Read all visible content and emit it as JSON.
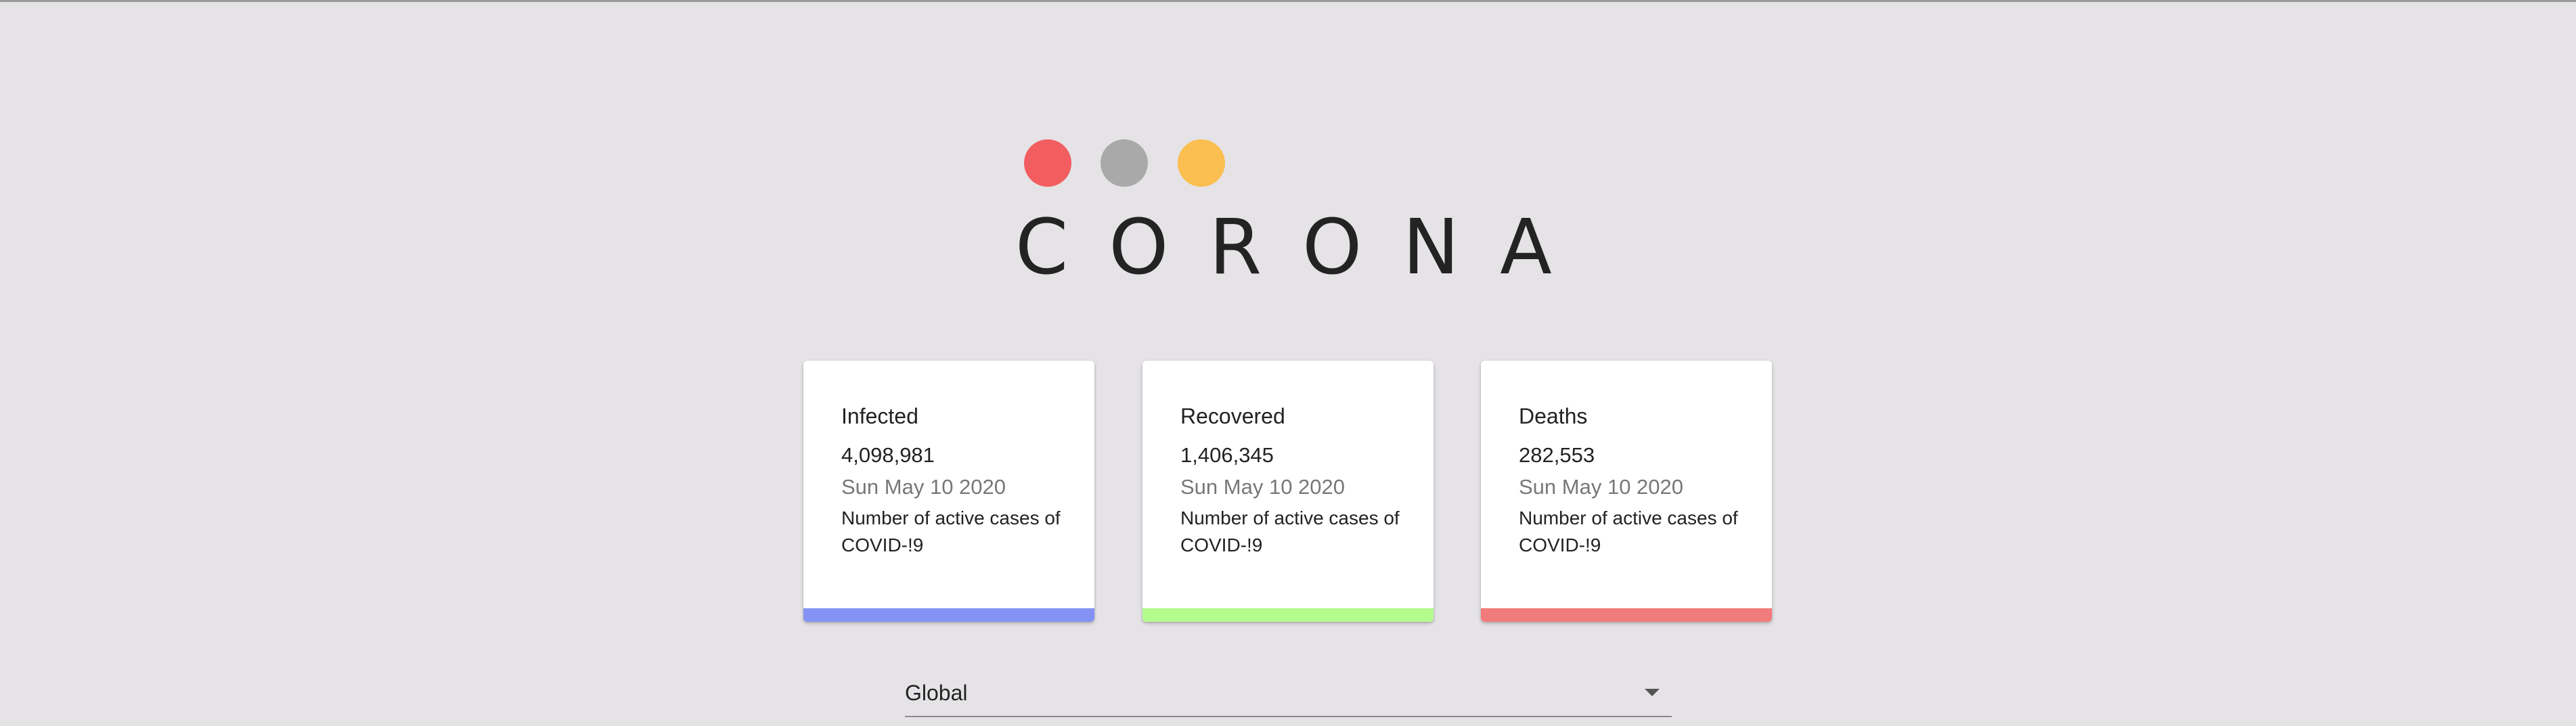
{
  "header": {
    "title": "CORONA",
    "dots": [
      {
        "name": "red",
        "color": "#f25e60"
      },
      {
        "name": "gray",
        "color": "#a9a9a9"
      },
      {
        "name": "orange",
        "color": "#fbbe50"
      }
    ]
  },
  "cards": [
    {
      "title": "Infected",
      "value": "4,098,981",
      "date": "Sun May 10 2020",
      "description": "Number of active cases of COVID-!9",
      "accent": "#8492f4"
    },
    {
      "title": "Recovered",
      "value": "1,406,345",
      "date": "Sun May 10 2020",
      "description": "Number of active cases of COVID-!9",
      "accent": "#b3fb8c"
    },
    {
      "title": "Deaths",
      "value": "282,553",
      "date": "Sun May 10 2020",
      "description": "Number of active cases of COVID-!9",
      "accent": "#f27b7b"
    }
  ],
  "country_select": {
    "value": "Global",
    "icon": "arrow-drop-down-icon"
  }
}
